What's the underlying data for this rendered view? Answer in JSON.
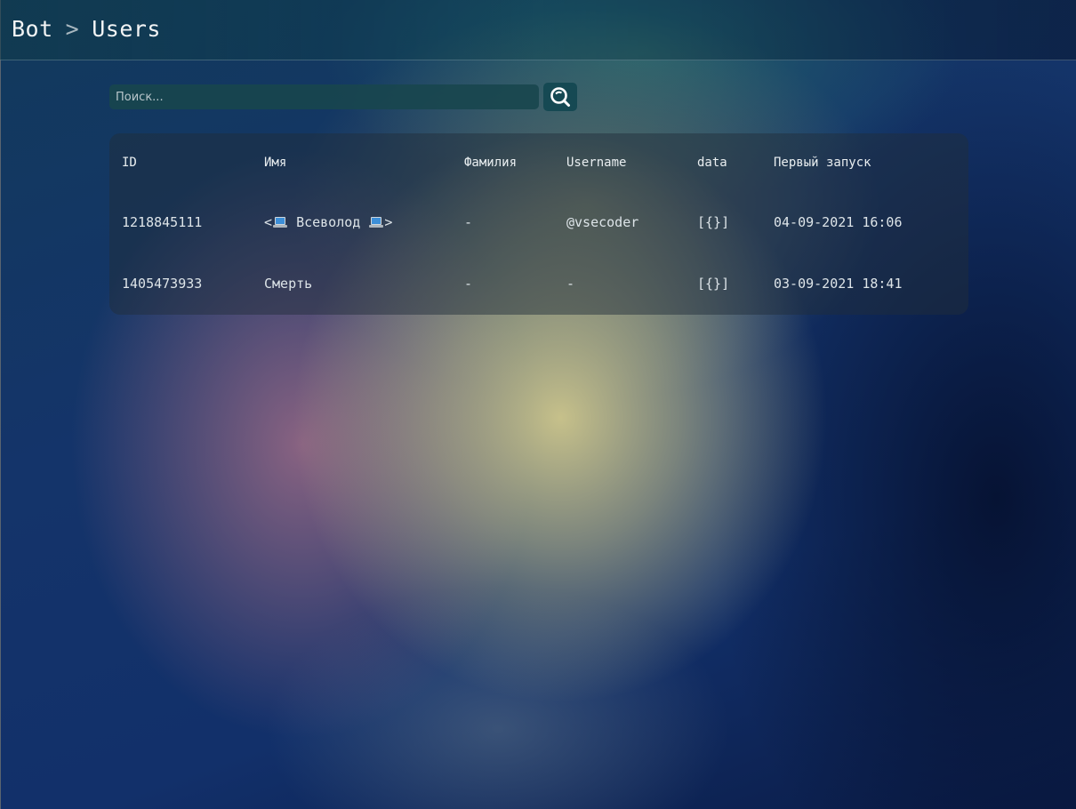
{
  "header": {
    "crumb_root": "Bot",
    "crumb_separator": ">",
    "crumb_current": "Users"
  },
  "search": {
    "placeholder": "Поиск...",
    "value": "",
    "button_icon": "search-icon"
  },
  "table": {
    "columns": [
      "ID",
      "Имя",
      "Фамилия",
      "Username",
      "data",
      "Первый запуск"
    ],
    "rows": [
      {
        "id": "1218845111",
        "name_prefix": "<",
        "name_text": "Всеволод",
        "name_suffix": ">",
        "name_icon": "laptop-icon",
        "last_name": "-",
        "username": "@vsecoder",
        "data": "[{}]",
        "first_launch": "04-09-2021 16:06"
      },
      {
        "id": "1405473933",
        "name": "Смерть",
        "last_name": "-",
        "username": "-",
        "data": "[{}]",
        "first_launch": "03-09-2021 18:41"
      }
    ]
  }
}
